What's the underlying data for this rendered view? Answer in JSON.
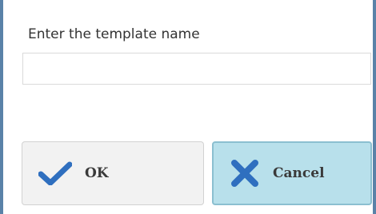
{
  "dialog": {
    "prompt": "Enter the template name",
    "input": {
      "value": "",
      "placeholder": ""
    },
    "ok_button": {
      "label": "OK",
      "icon": "checkmark-icon"
    },
    "cancel_button": {
      "label": "Cancel",
      "icon": "x-close-icon"
    }
  },
  "colors": {
    "frame": "#5a82a8",
    "icon_blue": "#2f6fbf",
    "cancel_bg": "#b8e0eb",
    "ok_bg": "#f2f2f2"
  }
}
